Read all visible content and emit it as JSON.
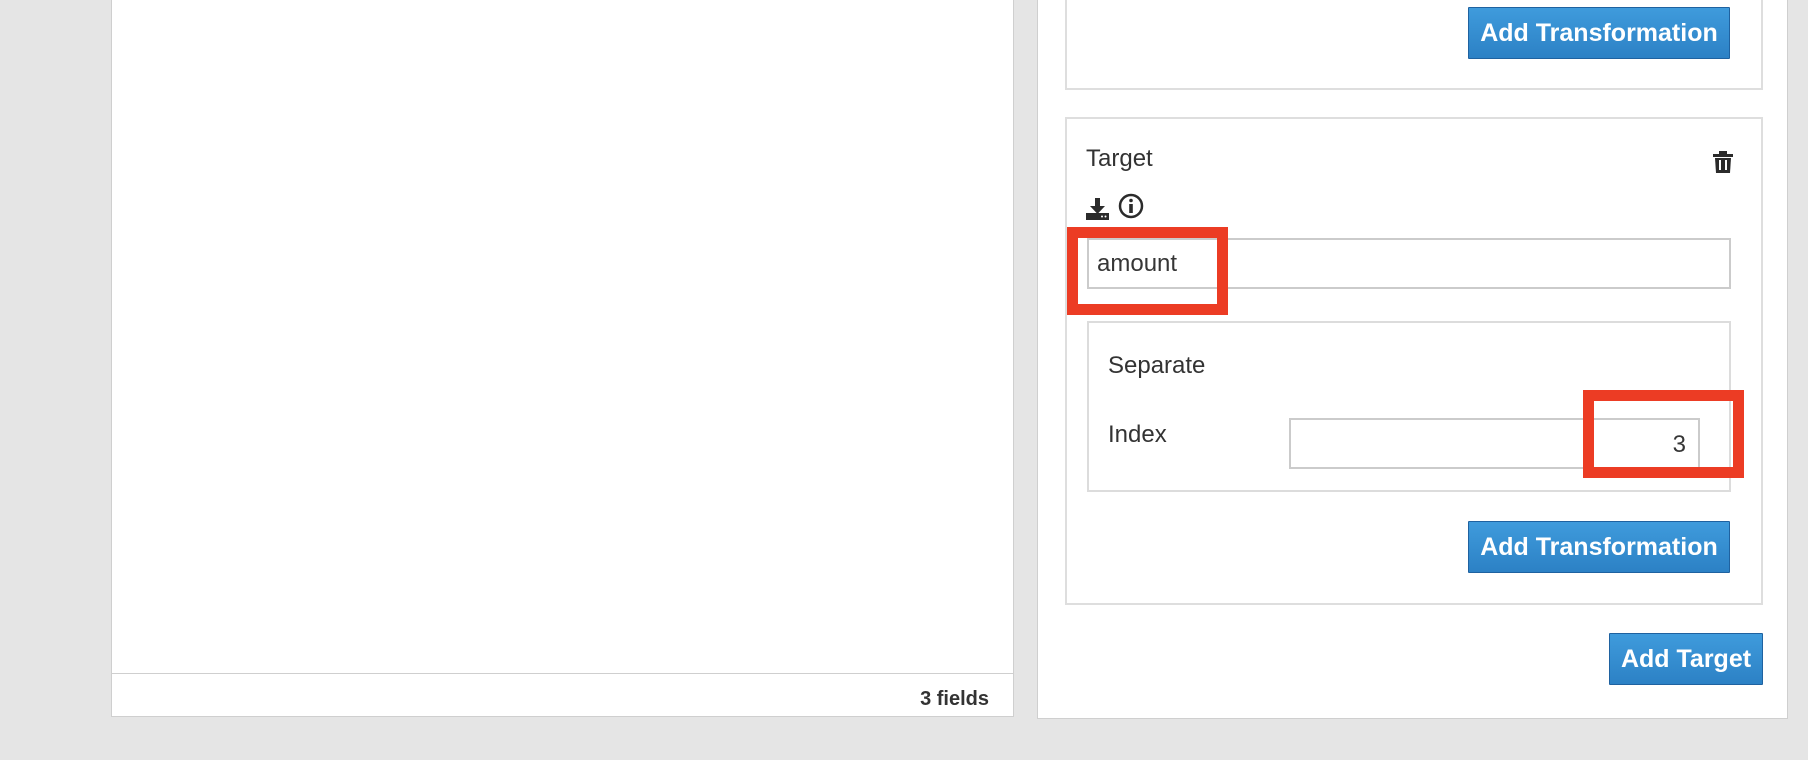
{
  "left_panel": {
    "fields_count": "3 fields"
  },
  "right_panel": {
    "top_card": {
      "add_transformation_label": "Add Transformation"
    },
    "target_card": {
      "title": "Target",
      "icons": [
        "download-icon",
        "info-icon",
        "trash-icon"
      ],
      "field_value": "amount",
      "transformation": {
        "title": "Separate",
        "index_label": "Index",
        "index_value": "3"
      },
      "add_transformation_label": "Add Transformation"
    },
    "add_target_label": "Add Target"
  },
  "colors": {
    "button": "#2c81c5",
    "highlight": "#ec3c24",
    "background": "#e5e5e5"
  }
}
